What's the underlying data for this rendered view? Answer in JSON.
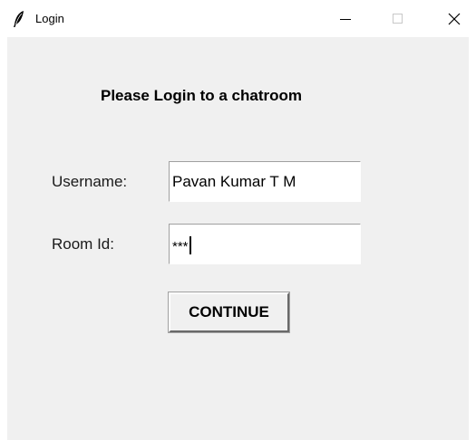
{
  "window": {
    "title": "Login",
    "icon": "feather-icon",
    "controls": {
      "minimize_icon": "minimize-icon",
      "maximize_icon": "maximize-icon",
      "close_icon": "close-icon"
    }
  },
  "form": {
    "heading": "Please Login to a chatroom",
    "username_label": "Username:",
    "username_value": "Pavan Kumar T M",
    "room_label": "Room Id:",
    "room_value": "***",
    "continue_label": "CONTINUE"
  },
  "colors": {
    "background": "#f0f0f0",
    "titlebar": "#ffffff",
    "field": "#ffffff"
  }
}
